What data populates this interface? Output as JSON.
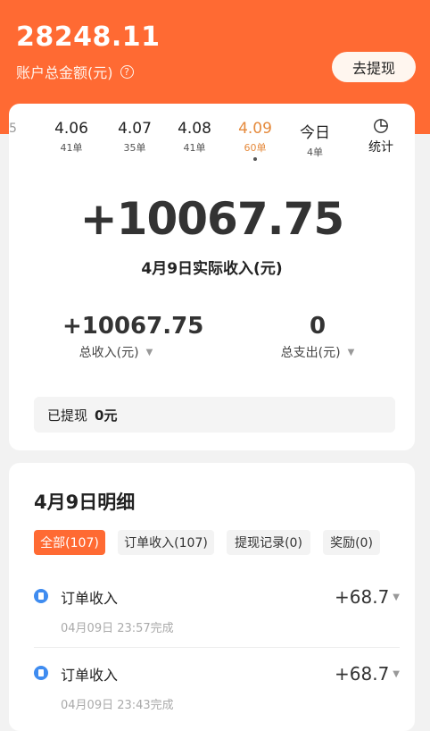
{
  "account": {
    "balance": "28248.11",
    "balance_label": "账户总金额(元)",
    "help_icon": "?",
    "withdraw_button": "去提现"
  },
  "date_tabs": {
    "partial": "5",
    "items": [
      {
        "date": "4.06",
        "count": "41单"
      },
      {
        "date": "4.07",
        "count": "35单"
      },
      {
        "date": "4.08",
        "count": "41单"
      },
      {
        "date": "4.09",
        "count": "60单"
      },
      {
        "date": "今日",
        "count": "4单"
      }
    ],
    "stats_label": "统计"
  },
  "summary": {
    "income": "+10067.75",
    "income_label": "4月9日实际收入(元)",
    "total_income": "+10067.75",
    "total_income_label": "总收入(元)",
    "total_expense": "0",
    "total_expense_label": "总支出(元)",
    "withdrawn_label": "已提现",
    "withdrawn_amount": "0元"
  },
  "details": {
    "title": "4月9日明细",
    "filters": [
      {
        "label": "全部(107)"
      },
      {
        "label": "订单收入(107)"
      },
      {
        "label": "提现记录(0)"
      },
      {
        "label": "奖励(0)"
      }
    ],
    "records": [
      {
        "title": "订单收入",
        "time": "04月09日 23:57完成",
        "amount": "+68.7"
      },
      {
        "title": "订单收入",
        "time": "04月09日 23:43完成",
        "amount": "+68.7"
      }
    ]
  },
  "colors": {
    "accent": "#ff6a33",
    "active_date": "#e58a3c",
    "record_icon": "#3f8cf0"
  }
}
